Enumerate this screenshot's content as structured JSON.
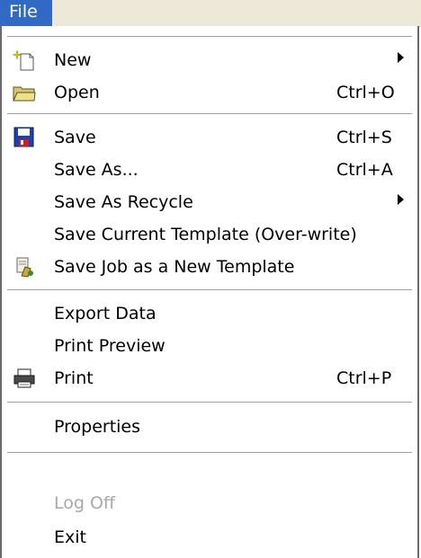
{
  "menubar": {
    "title": "File"
  },
  "menu": {
    "items": [
      {
        "label": "New",
        "shortcut": "",
        "icon": "new-file-sparkle-icon",
        "submenu": true
      },
      {
        "label": "Open",
        "shortcut": "Ctrl+O",
        "icon": "folder-open-icon"
      },
      {
        "label": "Save",
        "shortcut": "Ctrl+S",
        "icon": "floppy-disk-icon"
      },
      {
        "label": "Save As...",
        "shortcut": "Ctrl+A"
      },
      {
        "label": "Save As Recycle",
        "submenu": true
      },
      {
        "label": "Save Current Template (Over-write)"
      },
      {
        "label": "Save Job as a New Template",
        "icon": "template-job-icon"
      },
      {
        "label": "Export Data"
      },
      {
        "label": "Print Preview"
      },
      {
        "label": "Print",
        "shortcut": "Ctrl+P",
        "icon": "printer-icon"
      },
      {
        "label": "Properties"
      },
      {
        "label": "Log Off",
        "disabled": true
      },
      {
        "label": "Exit"
      }
    ]
  },
  "colors": {
    "highlight": "#316ac5",
    "disabled_text": "#a8a8a8",
    "menubar_bg": "#ece9d8"
  }
}
